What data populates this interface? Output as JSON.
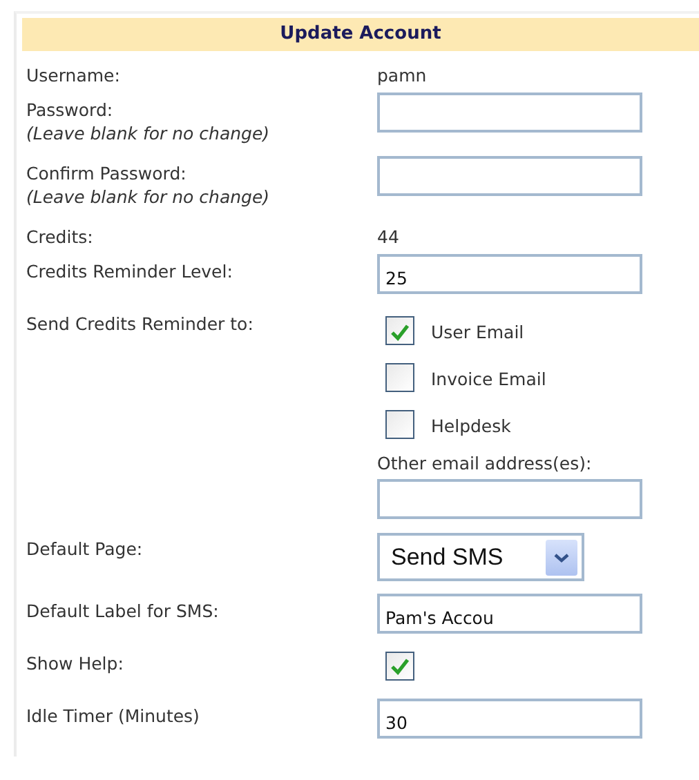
{
  "title": "Update Account",
  "fields": [
    {
      "kind": "text",
      "label": "Username:",
      "value": "pamn"
    },
    {
      "kind": "input",
      "label": "Password:",
      "hint": "(Leave blank for no change)"
    },
    {
      "kind": "input",
      "label": "Confirm Password:",
      "hint": "(Leave blank for no change)"
    },
    {
      "kind": "text",
      "label": "Credits:",
      "value": "44"
    },
    {
      "kind": "input",
      "label": "Credits Reminder Level:",
      "value": "25"
    },
    {
      "kind": "checks",
      "label": "Send Credits Reminder to:",
      "options": [
        {
          "label": "User Email",
          "checked": true
        },
        {
          "label": "Invoice Email",
          "checked": false
        },
        {
          "label": "Helpdesk",
          "checked": false
        }
      ],
      "other_label": "Other email address(es):"
    },
    {
      "kind": "select",
      "label": "Default Page:",
      "value": "Send SMS"
    },
    {
      "kind": "input",
      "label": "Default Label for SMS:",
      "value": "Pam's Accou"
    },
    {
      "kind": "checkbox",
      "label": "Show Help:",
      "checked": true
    },
    {
      "kind": "input",
      "label": "Idle Timer (Minutes)",
      "value": "30"
    }
  ]
}
